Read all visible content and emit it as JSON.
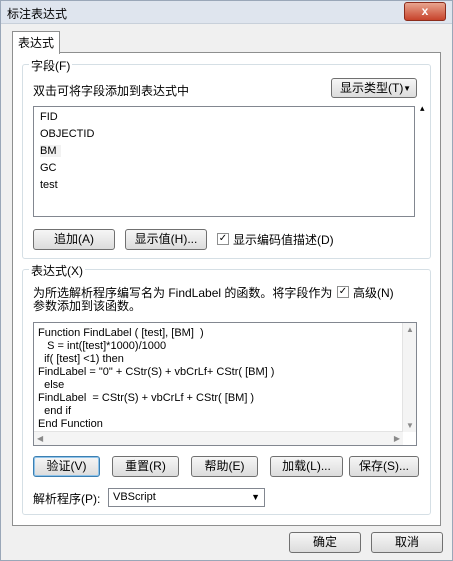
{
  "window": {
    "title": "标注表达式",
    "close_label": "x"
  },
  "tabs": [
    {
      "label": "表达式"
    }
  ],
  "fields_group": {
    "legend": "字段(F)",
    "hint": "双击可将字段添加到表达式中",
    "show_types_label": "显示类型(T)",
    "items": [
      "FID",
      "OBJECTID",
      "BM",
      "GC",
      "test"
    ],
    "append_label": "追加(A)",
    "show_values_label": "显示值(H)...",
    "show_coded_label": "显示编码值描述(D)",
    "show_coded_checked": true
  },
  "expression_group": {
    "legend": "表达式(X)",
    "desc_line1": "为所选解析程序编写名为 FindLabel 的函数。将字段作为",
    "desc_line2": "参数添加到该函数。",
    "advanced_label": "高级(N)",
    "advanced_checked": true,
    "code_lines": [
      "Function FindLabel ( [test], [BM]  )",
      "   S = int([test]*1000)/1000",
      "  if( [test] <1) then",
      "FindLabel = \"0\" + CStr(S) + vbCrLf+ CStr( [BM] )",
      "  else",
      "FindLabel  = CStr(S) + vbCrLf + CStr( [BM] )",
      "  end if",
      "End Function"
    ],
    "buttons": {
      "verify": "验证(V)",
      "reset": "重置(R)",
      "help": "帮助(E)",
      "load": "加载(L)...",
      "save": "保存(S)..."
    },
    "parser_label": "解析程序(P):",
    "parser_value": "VBScript"
  },
  "footer": {
    "ok_label": "确定",
    "cancel_label": "取消"
  }
}
